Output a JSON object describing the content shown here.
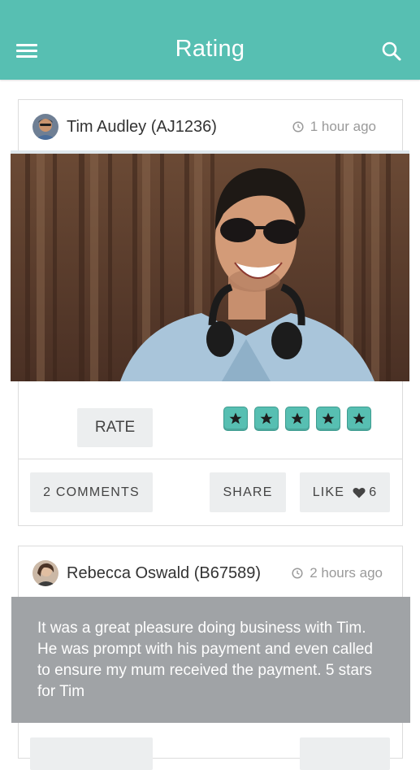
{
  "app": {
    "title": "Rating"
  },
  "posts": [
    {
      "author": "Tim Audley (AJ1236)",
      "time": "1 hour ago",
      "rate_label": "RATE",
      "stars": 5,
      "comments_label": "2 COMMENTS",
      "share_label": "SHARE",
      "like_label": "LIKE",
      "like_count": "6"
    },
    {
      "author": "Rebecca Oswald (B67589)",
      "time": "2 hours ago",
      "review": "It was a great pleasure doing business with Tim. He was prompt with his payment and even called to ensure my mum received the payment. 5 stars for Tim"
    }
  ],
  "colors": {
    "accent": "#57bfb2",
    "review_bg": "#a0a3a6",
    "button_bg": "#eceeef"
  },
  "icons": [
    "menu-icon",
    "search-icon",
    "clock-icon",
    "star-icon",
    "heart-icon"
  ]
}
